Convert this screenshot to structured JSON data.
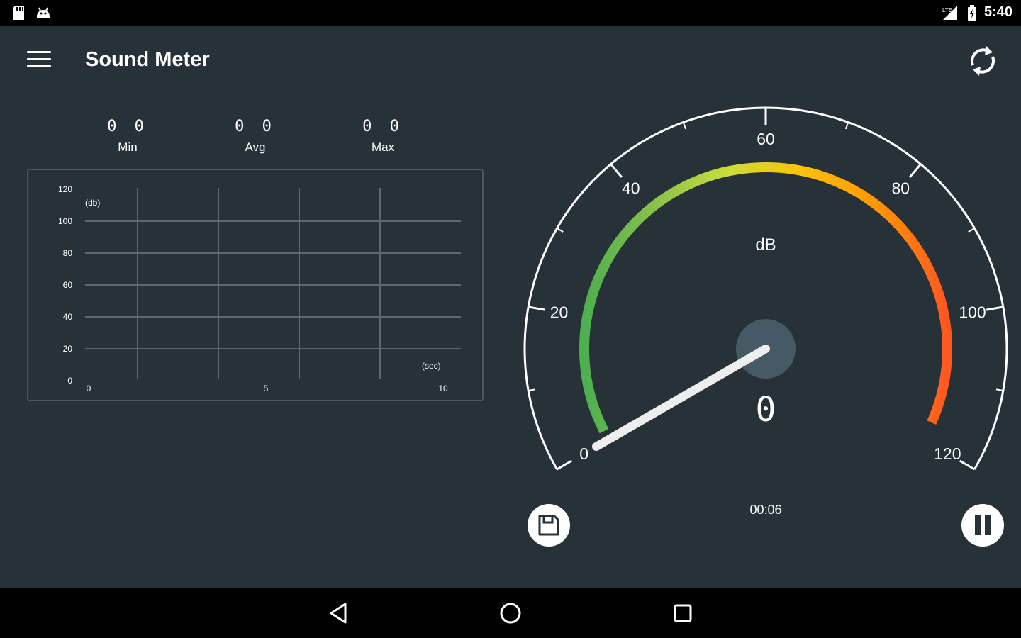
{
  "status_bar": {
    "time": "5:40",
    "icons": [
      "sd-card-icon",
      "android-icon",
      "signal-icon",
      "battery-icon"
    ]
  },
  "app_bar": {
    "title": "Sound Meter",
    "menu_icon": "hamburger-menu-icon",
    "reset_icon": "refresh-icon"
  },
  "stats": [
    {
      "label": "Min",
      "value": "0 0"
    },
    {
      "label": "Avg",
      "value": "0 0"
    },
    {
      "label": "Max",
      "value": "0 0"
    }
  ],
  "history_chart": {
    "y_unit": "(db)",
    "x_unit": "(sec)",
    "y_ticks": [
      "120",
      "100",
      "80",
      "60",
      "40",
      "20",
      "0"
    ],
    "x_ticks": [
      "0",
      "5",
      "10"
    ],
    "ylim": [
      0,
      120
    ],
    "xlim": [
      0,
      10
    ]
  },
  "gauge": {
    "unit": "dB",
    "reading": "0",
    "needle_value": 0,
    "min": 0,
    "max": 120,
    "major_labels": [
      "0",
      "20",
      "40",
      "60",
      "80",
      "100",
      "120"
    ],
    "arc_colors": [
      "#4CAF50",
      "#8BC34A",
      "#CDDC39",
      "#FFC107",
      "#FF9800",
      "#FF5722"
    ]
  },
  "elapsed_time": "00:06",
  "controls": {
    "save_icon": "floppy-disk-icon",
    "pause_icon": "pause-icon"
  },
  "nav_bar": {
    "icons": [
      "back-icon",
      "home-icon",
      "recents-icon"
    ]
  },
  "colors": {
    "background": "#263238",
    "panel_border": "#4b575e",
    "needle": "#eeeeee",
    "hub": "#455a64"
  }
}
